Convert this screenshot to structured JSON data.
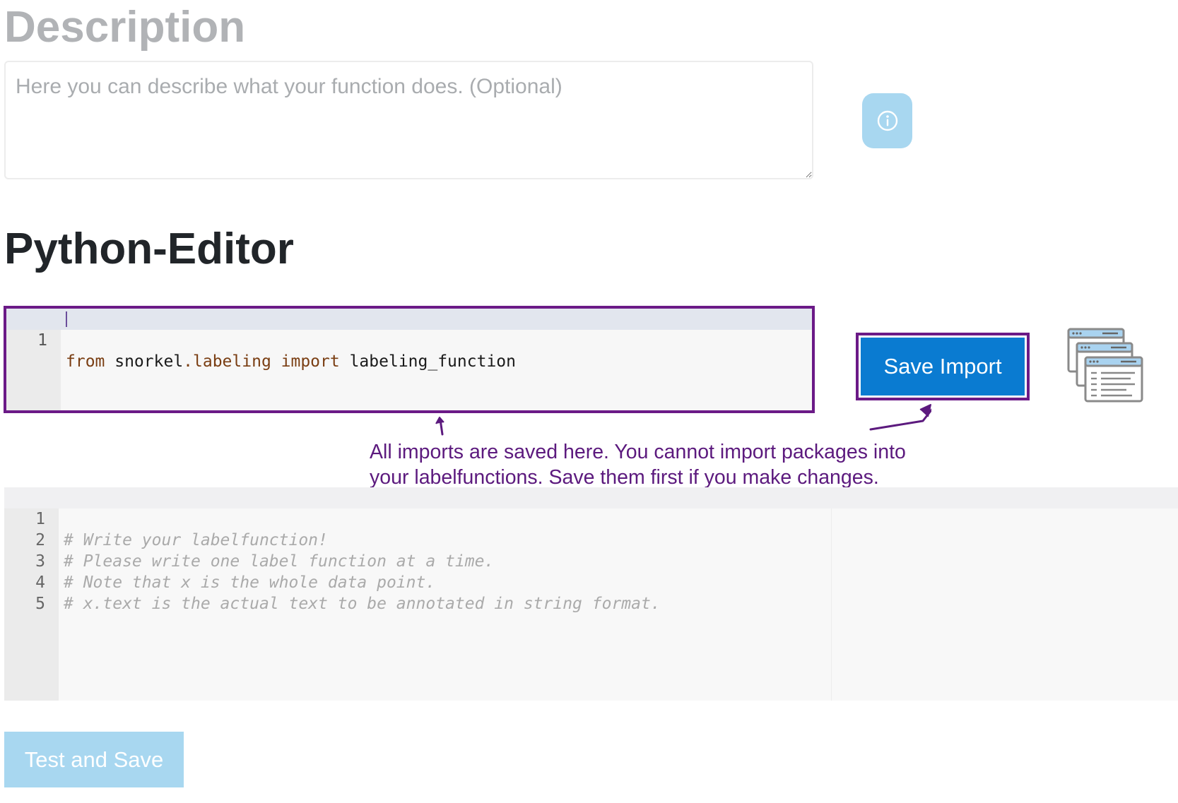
{
  "description_section": {
    "heading": "Description",
    "placeholder": "Here you can describe what your function does. (Optional)",
    "value": ""
  },
  "info_button": {
    "icon": "info-icon"
  },
  "python_editor_section": {
    "heading": "Python-Editor"
  },
  "import_editor": {
    "lines": [
      {
        "number": "1",
        "tokens": [
          {
            "text": "from",
            "kind": "keyword"
          },
          {
            "text": " snorkel",
            "kind": "plain"
          },
          {
            "text": ".labeling",
            "kind": "module"
          },
          {
            "text": " import",
            "kind": "keyword"
          },
          {
            "text": " labeling_function",
            "kind": "plain"
          }
        ]
      }
    ]
  },
  "save_import_button": {
    "label": "Save Import"
  },
  "import_icon": {
    "icon": "stacked-windows-icon"
  },
  "annotation": {
    "line1": "All imports are saved here. You cannot import packages into",
    "line2": "your labelfunctions. Save them first if you make changes."
  },
  "code_editor": {
    "lines": [
      {
        "number": "1",
        "text": "# Write your labelfunction!"
      },
      {
        "number": "2",
        "text": "# Please write one label function at a time."
      },
      {
        "number": "3",
        "text": "# Note that x is the whole data point."
      },
      {
        "number": "4",
        "text": "# x.text is the actual text to be annotated in string format."
      },
      {
        "number": "5",
        "text": ""
      }
    ]
  },
  "test_and_save_button": {
    "label": "Test and Save"
  },
  "colors": {
    "annotation": "#5c1a7e",
    "primary_button": "#0a7bd1",
    "disabled_button": "#a8d7f0",
    "muted_heading": "#b1b3b6"
  }
}
